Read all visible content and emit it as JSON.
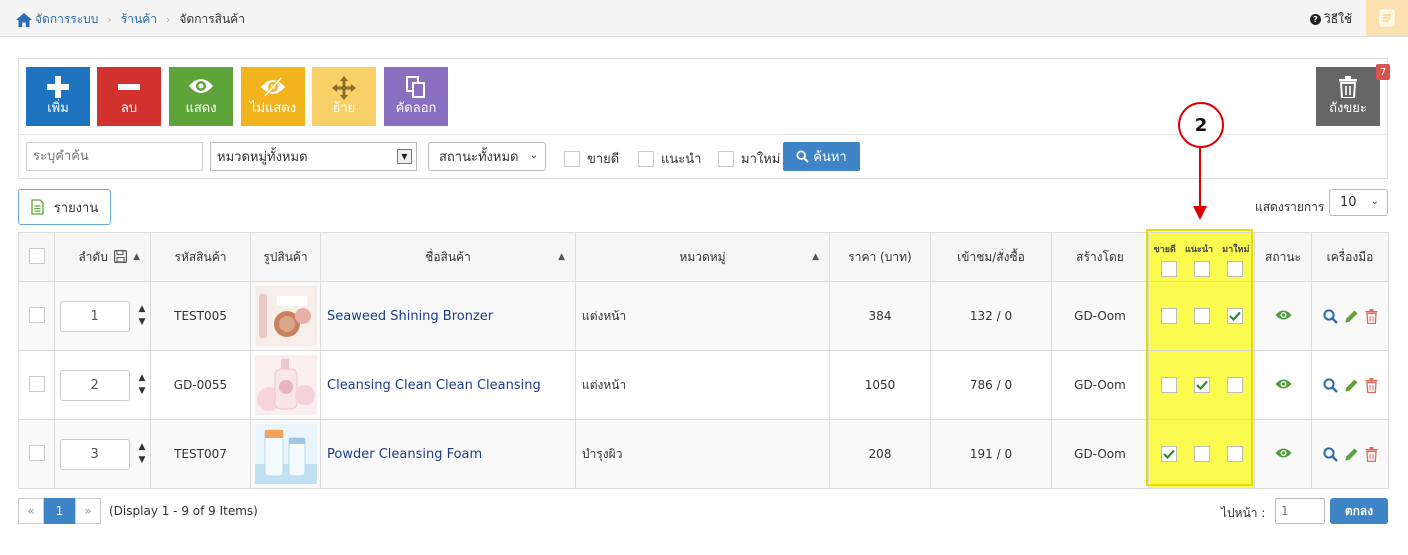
{
  "breadcrumb": {
    "home": "จัดการระบบ",
    "shop": "ร้านค้า",
    "current": "จัดการสินค้า"
  },
  "help_label": "วิธีใช้",
  "toolbar": {
    "add": "เพิ่ม",
    "delete": "ลบ",
    "show": "แสดง",
    "hide": "ไม่แสดง",
    "move": "ย้าย",
    "copy": "คัดลอก",
    "trash": "ถังขยะ",
    "trash_count": "7"
  },
  "filters": {
    "search_placeholder": "ระบุคำค้น",
    "category": "หมวดหมู่ทั้งหมด",
    "status": "สถานะทั้งหมด",
    "bestseller": "ขายดี",
    "recommended": "แนะนำ",
    "new": "มาใหม่",
    "search_button": "ค้นหา"
  },
  "report_label": "รายงาน",
  "page_size": {
    "label": "แสดงรายการ",
    "value": "10"
  },
  "annotation": "2",
  "table": {
    "headers": {
      "order": "ลำดับ",
      "code": "รหัสสินค้า",
      "image": "รูปสินค้า",
      "name": "ชื่อสินค้า",
      "category": "หมวดหมู่",
      "price": "ราคา (บาท)",
      "views": "เข้าชม/สั่งซื้อ",
      "creator": "สร้างโดย",
      "flag_bestseller": "ขายดี",
      "flag_recommended": "แนะนำ",
      "flag_new": "มาใหม่",
      "status": "สถานะ",
      "tools": "เครื่องมือ"
    },
    "rows": [
      {
        "order": "1",
        "code": "TEST005",
        "name": "Seaweed Shining Bronzer",
        "category": "แต่งหน้า",
        "price": "384",
        "views": "132 / 0",
        "creator": "GD-Oom",
        "bestseller": false,
        "recommended": false,
        "new": true
      },
      {
        "order": "2",
        "code": "GD-0055",
        "name": "Cleansing Clean Clean Cleansing",
        "category": "แต่งหน้า",
        "price": "1050",
        "views": "786 / 0",
        "creator": "GD-Oom",
        "bestseller": false,
        "recommended": true,
        "new": false
      },
      {
        "order": "3",
        "code": "TEST007",
        "name": "Powder Cleansing Foam",
        "category": "บำรุงผิว",
        "price": "208",
        "views": "191 / 0",
        "creator": "GD-Oom",
        "bestseller": true,
        "recommended": false,
        "new": false
      }
    ]
  },
  "pagination": {
    "prev": "«",
    "page": "1",
    "next": "»",
    "info": "(Display 1 - 9 of 9 Items)",
    "goto_label": "ไปหน้า :",
    "goto_value": "1",
    "ok": "ตกลง"
  }
}
